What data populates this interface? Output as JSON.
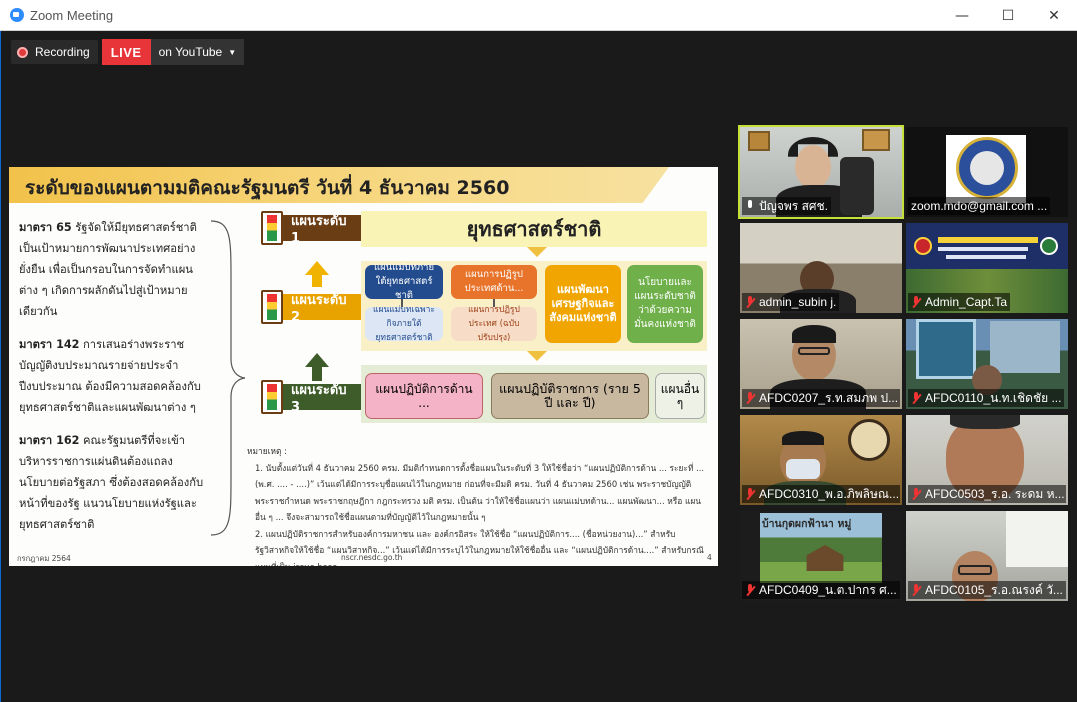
{
  "window": {
    "title": "Zoom Meeting",
    "controls": [
      "—",
      "☐",
      "✕"
    ]
  },
  "recording": {
    "label": "Recording",
    "live_badge": "LIVE",
    "stream_target": "on YouTube"
  },
  "slide": {
    "title": "ระดับของแผนตามมติคณะรัฐมนตรี วันที่ 4 ธันวาคม 2560",
    "left_paragraphs": [
      {
        "lead": "มาตรา 65",
        "text": " รัฐจัดให้มียุทธศาสตร์ชาติเป็นเป้าหมายการพัฒนาประเทศอย่างยั่งยืน เพื่อเป็นกรอบในการจัดทำแผนต่าง ๆ เกิดการผลักดันไปสู่เป้าหมายเดียวกัน"
      },
      {
        "lead": "มาตรา 142",
        "text": " การเสนอร่างพระราชบัญญัติงบประมาณรายจ่ายประจำปีงบประมาณ ต้องมีความสอดคล้องกับยุทธศาสตร์ชาติและแผนพัฒนาต่าง ๆ"
      },
      {
        "lead": "มาตรา 162",
        "text": " คณะรัฐมนตรีที่จะเข้าบริหารราชการแผ่นดินต้องแถลงนโยบายต่อรัฐสภา ซึ่งต้องสอดคล้องกับหน้าที่ของรัฐ แนวนโยบายแห่งรัฐและยุทธศาสตร์ชาติ"
      }
    ],
    "levels": [
      {
        "label": "แผนระดับ 1",
        "color": "#6b3d14"
      },
      {
        "label": "แผนระดับ 2",
        "color": "#e8a300"
      },
      {
        "label": "แผนระดับ 3",
        "color": "#3e5c2a"
      }
    ],
    "level1_box": "ยุทธศาสตร์ชาติ",
    "level2_boxes": [
      {
        "text": "แผนแม่บทภายใต้ยุทธศาสตร์ชาติ",
        "bg": "#234c8e",
        "fg": "#ffffff"
      },
      {
        "text": "แผนการปฏิรูปประเทศด้าน...",
        "bg": "#e8732a",
        "fg": "#ffffff"
      },
      {
        "text": "แผนพัฒนาเศรษฐกิจและสังคมแห่งชาติ",
        "bg": "#f0a500",
        "fg": "#ffffff"
      },
      {
        "text": "นโยบายและแผนระดับชาติว่าด้วยความมั่นคงแห่งชาติ",
        "bg": "#6fb04a",
        "fg": "#ffffff"
      },
      {
        "text": "แผนแม่บทเฉพาะกิจภายใต้ยุทธศาสตร์ชาติ",
        "bg": "#dde6f4",
        "fg": "#234c8e"
      },
      {
        "text": "แผนการปฏิรูปประเทศ (ฉบับปรับปรุง)",
        "bg": "#f7dcc8",
        "fg": "#a0461a"
      }
    ],
    "level3_boxes": [
      {
        "text": "แผนปฏิบัติการด้าน ...",
        "bg": "#f5b3c8",
        "fg": "#333333"
      },
      {
        "text": "แผนปฏิบัติราชการ (ราย 5 ปี และ ปี)",
        "bg": "#c9b8a0",
        "fg": "#222222"
      },
      {
        "text": "แผนอื่น ๆ",
        "bg": "#eef1e6",
        "fg": "#222222"
      }
    ],
    "notes_heading": "หมายเหตุ :",
    "notes": [
      "1. นับตั้งแต่วันที่ 4 ธันวาคม 2560 ครม. มีมติกำหนดการตั้งชื่อแผนในระดับที่ 3 ให้ใช้ชื่อว่า “แผนปฏิบัติการด้าน ... ระยะที่ ... (พ.ศ. .... - ....)” เว้นแต่ได้มีการระบุชื่อแผนไว้ในกฎหมาย ก่อนที่จะมีมติ ครม. วันที่ 4 ธันวาคม 2560 เช่น พระราชบัญญัติ พระราชกำหนด พระราชกฤษฎีกา กฎกระทรวง มติ ครม. เป็นต้น ว่าให้ใช้ชื่อแผนว่า แผนแม่บทด้าน... แผนพัฒนา... หรือ แผนอื่น ๆ ... จึงจะสามารถใช้ชื่อแผนตามที่บัญญัติไว้ในกฎหมายนั้น ๆ",
      "2. แผนปฏิบัติราชการสำหรับองค์การมหาชน และ องค์กรอิสระ ให้ใช้ชื่อ “แผนปฏิบัติการ.... (ชื่อหน่วยงาน)...” สำหรับรัฐวิสาหกิจให้ใช้ชื่อ “แผนวิสาหกิจ...” เว้นแต่ได้มีการระบุไว้ในกฎหมายให้ใช้ชื่ออื่น และ “แผนปฏิบัติการด้าน....” สำหรับกรณีแผนที่เป็น issue base"
    ],
    "footer_left": "กรกฎาคม 2564",
    "footer_center": "nscr.nesdc.go.th",
    "footer_right": "4"
  },
  "participants": [
    {
      "name": "ปัญจพร สศช.",
      "muted": false,
      "active": true
    },
    {
      "name": "zoom.mdo@gmail.com ...",
      "muted": false,
      "active": false
    },
    {
      "name": "admin_subin j.",
      "muted": true,
      "active": false
    },
    {
      "name": "Admin_Capt.Ta",
      "muted": true,
      "active": false
    },
    {
      "name": "AFDC0207_ร.ท.สมภพ ป...",
      "muted": true,
      "active": false
    },
    {
      "name": "AFDC0110_น.ท.เชิดชัย ...",
      "muted": true,
      "active": false
    },
    {
      "name": "AFDC0310_พ.อ.ภิพลิษณ...",
      "muted": true,
      "active": false
    },
    {
      "name": "AFDC0503_ร.อ. ระดม ห...",
      "muted": true,
      "active": false
    },
    {
      "name": "AFDC0409_น.ต.ปากร ศ...",
      "muted": true,
      "active": false
    },
    {
      "name": "AFDC0105_ร.อ.ณรงค์ วั...",
      "muted": true,
      "active": false
    }
  ],
  "tile_texts": {
    "tile8_banner": "บ้านกุดผกฟ้านา หมู่"
  },
  "colors": {
    "live_red": "#e8353a",
    "active_speaker": "#c6e03a",
    "slide_title_band": "#f2c24a"
  }
}
